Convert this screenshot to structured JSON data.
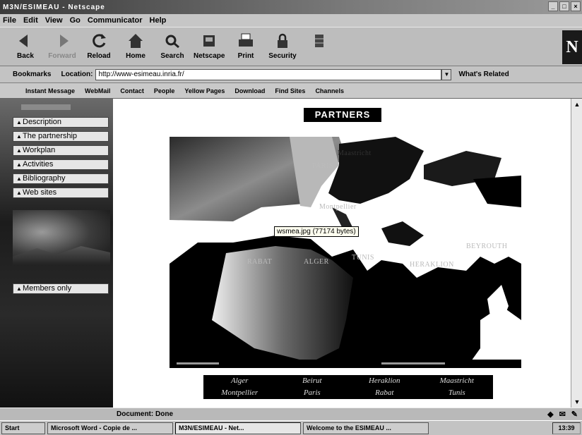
{
  "window": {
    "title": "M3N/ESIMEAU - Netscape"
  },
  "menu": [
    "File",
    "Edit",
    "View",
    "Go",
    "Communicator",
    "Help"
  ],
  "toolbar": [
    {
      "label": "Back",
      "icon": "back-icon"
    },
    {
      "label": "Forward",
      "icon": "forward-icon"
    },
    {
      "label": "Reload",
      "icon": "reload-icon"
    },
    {
      "label": "Home",
      "icon": "home-icon"
    },
    {
      "label": "Search",
      "icon": "search-icon"
    },
    {
      "label": "Netscape",
      "icon": "netscape-icon"
    },
    {
      "label": "Print",
      "icon": "print-icon"
    },
    {
      "label": "Security",
      "icon": "security-icon"
    },
    {
      "label": "",
      "icon": "stop-icon"
    }
  ],
  "location": {
    "bookmarks_label": "Bookmarks",
    "location_label": "Location:",
    "url": "http://www-esimeau.inria.fr/",
    "related_label": "What's Related"
  },
  "personal_toolbar": [
    "Instant Message",
    "WebMail",
    "Contact",
    "People",
    "Yellow Pages",
    "Download",
    "Find Sites",
    "Channels"
  ],
  "sidebar": {
    "items": [
      "Description",
      "The partnership",
      "Workplan",
      "Activities",
      "Bibliography",
      "Web sites"
    ],
    "members_label": "Members only"
  },
  "page": {
    "heading": "PARTNERS",
    "tooltip": "wsmea.jpg (77174 bytes)",
    "cities": [
      "Maastricht",
      "PARIS",
      "Montpellier",
      "RABAT",
      "ALGER",
      "TUNIS",
      "BEYROUTH",
      "HERAKLION"
    ],
    "legend": [
      "Alger",
      "Beirut",
      "Heraklion",
      "Maastricht",
      "Montpellier",
      "Paris",
      "Rabat",
      "Tunis"
    ]
  },
  "status": {
    "text": "Document: Done"
  },
  "taskbar": {
    "start": "Start",
    "items": [
      "Microsoft Word - Copie de ...",
      "M3N/ESIMEAU - Net...",
      "Welcome to the ESIMEAU ..."
    ],
    "clock": "13:39"
  }
}
